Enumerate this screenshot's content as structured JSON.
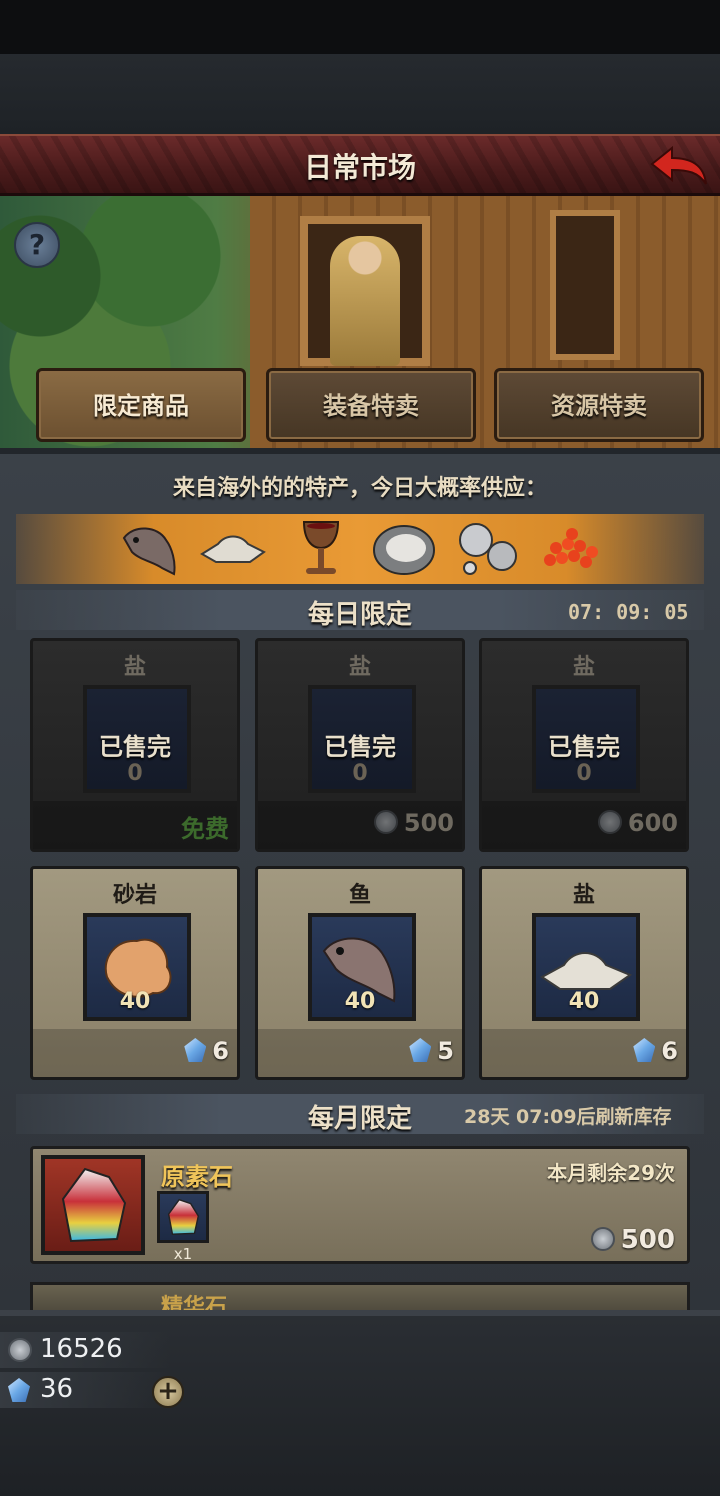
{
  "header": {
    "title": "日常市场",
    "back_icon": "back-arrow-icon"
  },
  "banner": {
    "help_label": "?"
  },
  "tabs": [
    {
      "label": "限定商品",
      "active": true
    },
    {
      "label": "装备特卖",
      "active": false
    },
    {
      "label": "资源特卖",
      "active": false
    }
  ],
  "supply": {
    "text": "来自海外的的特产，今日大概率供应：",
    "icons": [
      "fish-icon",
      "salt-icon",
      "goblet-icon",
      "oyster-icon",
      "pearls-icon",
      "roe-icon"
    ]
  },
  "daily": {
    "title": "每日限定",
    "timer": "07: 09: 05",
    "sold_items": [
      {
        "name": "盐",
        "status": "已售完",
        "qty": "0",
        "price": "免费",
        "currency": ""
      },
      {
        "name": "盐",
        "status": "已售完",
        "qty": "0",
        "price": "500",
        "currency": "silver-coin-icon"
      },
      {
        "name": "盐",
        "status": "已售完",
        "qty": "0",
        "price": "600",
        "currency": "silver-coin-icon"
      }
    ],
    "items": [
      {
        "name": "砂岩",
        "qty": "40",
        "price": "6",
        "icon": "sandstone-icon",
        "currency": "crystal-icon"
      },
      {
        "name": "鱼",
        "qty": "40",
        "price": "5",
        "icon": "fish-icon",
        "currency": "crystal-icon"
      },
      {
        "name": "盐",
        "qty": "40",
        "price": "6",
        "icon": "salt-icon",
        "currency": "crystal-icon"
      }
    ]
  },
  "monthly": {
    "title": "每月限定",
    "refresh": "28天 07:09后刷新库存",
    "items": [
      {
        "name": "原素石",
        "remaining": "本月剩余29次",
        "mini_qty": "x1",
        "price": "500",
        "icon": "element-stone-icon",
        "currency": "silver-coin-icon"
      },
      {
        "name": "精华石"
      }
    ]
  },
  "resources": {
    "silver": "16526",
    "crystal": "36",
    "plus_label": "+"
  },
  "colors": {
    "accent_orange": "#e99a35",
    "title_bar": "#4a1b1b",
    "gold_text": "#f0c55a"
  }
}
